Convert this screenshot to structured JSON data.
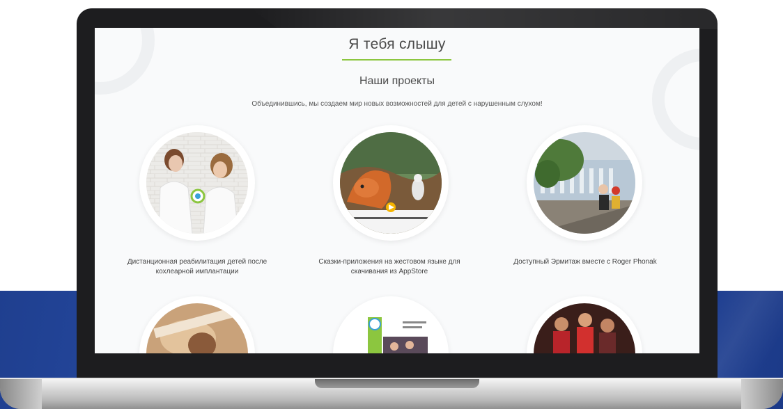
{
  "site": {
    "brand_title": "Я тебя слышу",
    "section_title": "Наши проекты",
    "section_subtitle": "Объединившись, мы создаем мир новых возможностей для детей с нарушенным слухом!"
  },
  "projects": [
    {
      "caption_line1": "Дистанционная реабилитация детей после",
      "caption_line2": "кохлеарной имплантации"
    },
    {
      "caption_line1": "Сказки-приложения на жестовом языке для",
      "caption_line2": "скачивания из AppStore"
    },
    {
      "caption_line1": "Доступный Эрмитаж вместе с Roger Phonak",
      "caption_line2": ""
    }
  ],
  "colors": {
    "accent_green": "#8cc63f",
    "band_blue": "#2b52b0",
    "laptop_frame": "#1d1d1f"
  }
}
